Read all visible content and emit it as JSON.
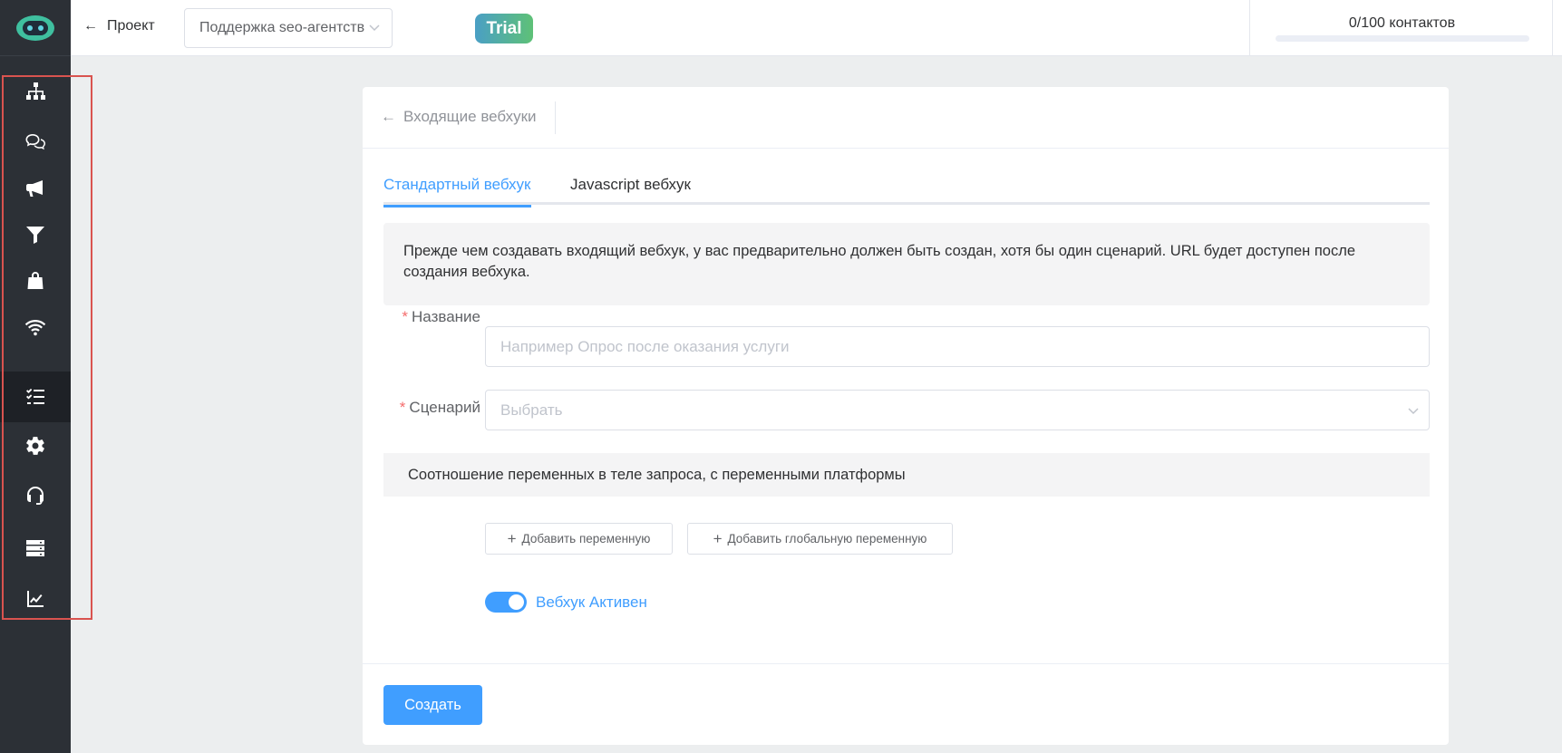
{
  "header": {
    "back_label": "Проект",
    "project_select_value": "Поддержка seo-агентства",
    "trial_badge": "Trial",
    "contacts_label": "0/100 контактов",
    "contacts_used": 0,
    "contacts_limit": 100
  },
  "sidebar": {
    "items": [
      {
        "icon": "sitemap-icon"
      },
      {
        "icon": "chat-icon"
      },
      {
        "icon": "megaphone-icon"
      },
      {
        "icon": "filter-icon"
      },
      {
        "icon": "shopping-bag-icon"
      },
      {
        "icon": "wifi-icon"
      },
      {
        "icon": "checklist-icon",
        "active": true
      },
      {
        "icon": "gear-icon"
      },
      {
        "icon": "headset-icon"
      },
      {
        "icon": "server-icon"
      },
      {
        "icon": "chart-line-icon"
      }
    ]
  },
  "card": {
    "breadcrumb": "Входящие вебхуки",
    "tabs": [
      {
        "label": "Стандартный вебхук",
        "active": true
      },
      {
        "label": "Javascript вебхук",
        "active": false
      }
    ],
    "info_text": "Прежде чем создавать входящий вебхук, у вас предварительно должен быть создан, хотя бы один сценарий. URL будет доступен после создания вебхука.",
    "name_label": "Название",
    "name_placeholder": "Например Опрос после оказания услуги",
    "scenario_label": "Сценарий",
    "scenario_placeholder": "Выбрать",
    "mapping_title": "Соотношение переменных в теле запроса, с переменными платформы",
    "add_variable_button": "Добавить переменную",
    "add_global_variable_button": "Добавить глобальную переменную",
    "toggle_label": "Вебхук Активен",
    "toggle_on": true,
    "create_button": "Создать"
  },
  "colors": {
    "accent": "#409eff",
    "sidebar_bg": "#2c3036",
    "highlight_border": "#d9534f",
    "required_asterisk": "#f56c6c"
  }
}
